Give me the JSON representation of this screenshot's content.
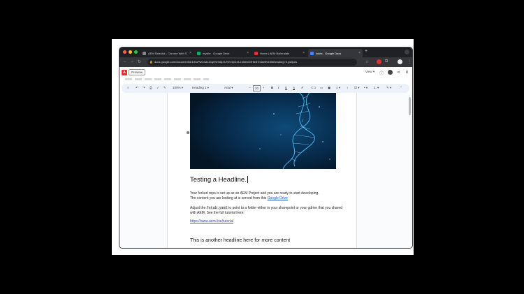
{
  "browser": {
    "tabs": [
      {
        "title": "AEM Sidekick - Chrome Web S",
        "active": false,
        "favicon": "chrome-webstore-icon"
      },
      {
        "title": "mysite - Google Drive",
        "active": false,
        "favicon": "google-drive-icon"
      },
      {
        "title": "Home | AEM Boilerplate",
        "active": false,
        "favicon": "aem-icon"
      },
      {
        "title": "index - Google Docs",
        "active": true,
        "favicon": "google-docs-icon"
      }
    ],
    "url": "docs.google.com/document/d/1rKaPwCwdLtGqrMvm8prLRVn/Q/2412158mO9hfe87mAWKledit#heading=h.gs5pos"
  },
  "sidekick": {
    "preview_label": "Preview",
    "view_label": "View",
    "logo_text": "A"
  },
  "toolbar": {
    "zoom": "100%",
    "style": "Heading 1",
    "font": "Arial",
    "font_size": "20",
    "bold": "B",
    "italic": "I",
    "underline": "U",
    "text_color": "A"
  },
  "document": {
    "heading": "Testing a Headline.",
    "para1_line1": "Your forked repo is set up as an AEM Project and you are ready to start developing.",
    "para1_line2": "The content you are looking at is served from this ",
    "para1_link": "Google Drive",
    "para2_pre": "Adjust the ",
    "para2_code": "fstab.yaml",
    "para2_post": " to point to a folder either in your sharepoint or your gdrive that you shared with AEM. See the full tutorial here:",
    "tutorial_link": "https://www.aem.live/tutorial",
    "heading2": "This is another headline here for more content"
  },
  "colors": {
    "aem_red": "#e03131",
    "link_blue": "#1a55c7",
    "chrome_dark": "#202124"
  }
}
